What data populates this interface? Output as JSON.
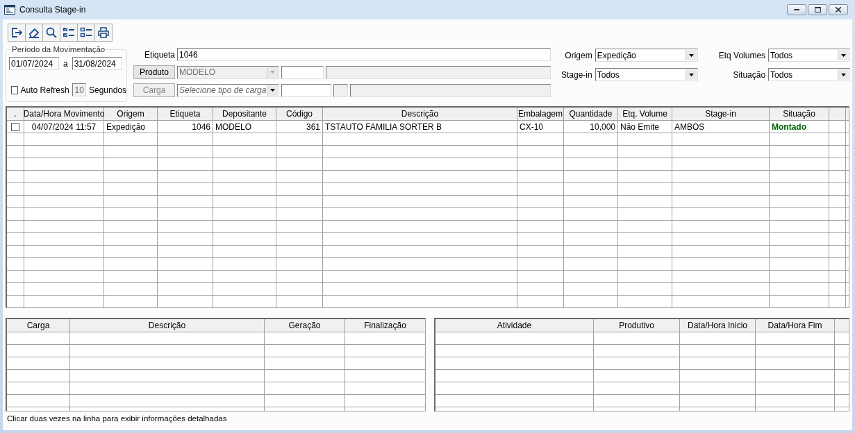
{
  "window": {
    "title": "Consulta Stage-in"
  },
  "period": {
    "legend": "Período da Movimentação",
    "from": "01/07/2024",
    "separator": "a",
    "to": "31/08/2024"
  },
  "auto_refresh": {
    "label": "Auto Refresh",
    "checked": false,
    "value": "10",
    "unit": "Segundos",
    "disabled": true
  },
  "etiqueta": {
    "label": "Etiqueta",
    "value": "1046"
  },
  "produto": {
    "button": "Produto",
    "button_disabled": false,
    "value": "MODELO",
    "disabled": true
  },
  "carga": {
    "button": "Carga",
    "button_disabled": true,
    "placeholder": "Selecione tipo de carga"
  },
  "filters": [
    {
      "label": "Origem",
      "value": "Expedição"
    },
    {
      "label": "Etq Volumes",
      "value": "Todos"
    },
    {
      "label": "Stage-in",
      "value": "Todos"
    },
    {
      "label": "Situação",
      "value": "Todos"
    }
  ],
  "table": {
    "columns": [
      ".",
      "Data/Hora Movimento",
      "Origem",
      "Etiqueta",
      "Depositante",
      "Código",
      "Descrição",
      "Embalagem",
      "Quantidade",
      "Etq. Volume",
      "Stage-in",
      "Situação"
    ],
    "rows": [
      {
        "checked": false,
        "cells": [
          "",
          "04/07/2024 11:57",
          "Expedição",
          "1046",
          "MODELO",
          "361",
          "TSTAUTO FAMILIA SORTER B",
          "CX-10",
          "10,000",
          "Não Emite",
          "AMBOS",
          "Montado"
        ],
        "color": "#006400"
      }
    ]
  },
  "cargas_table": {
    "columns": [
      "Carga",
      "Descrição",
      "Geração",
      "Finalização"
    ]
  },
  "atividades_table": {
    "columns": [
      "Atividade",
      "Produtivo",
      "Data/Hora Inicio",
      "Data/Hora Fim"
    ]
  },
  "status_bar": {
    "text": "Clicar duas vezes na linha para exibir informações detalhadas"
  }
}
